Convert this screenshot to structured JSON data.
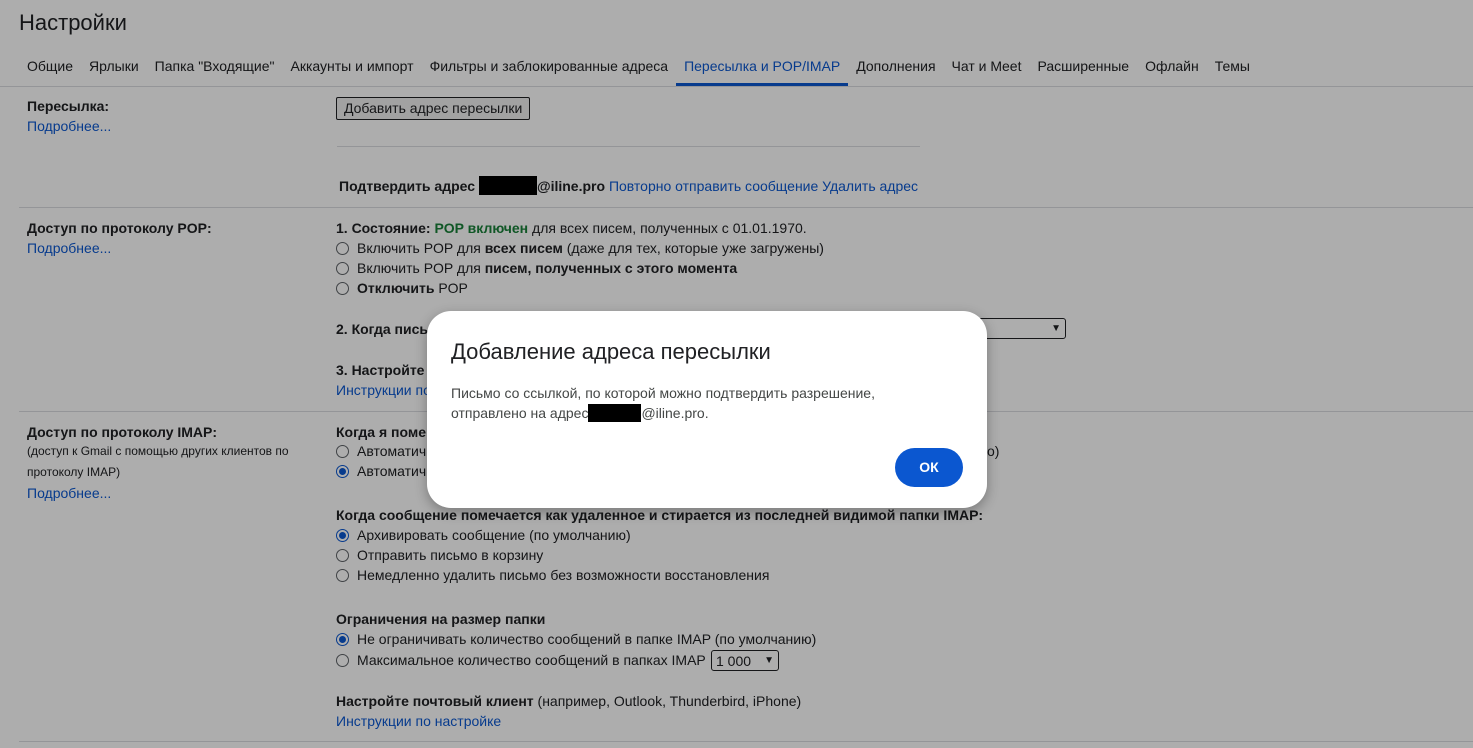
{
  "page_title": "Настройки",
  "tabs": [
    {
      "label": "Общие"
    },
    {
      "label": "Ярлыки"
    },
    {
      "label": "Папка \"Входящие\""
    },
    {
      "label": "Аккаунты и импорт"
    },
    {
      "label": "Фильтры и заблокированные адреса"
    },
    {
      "label": "Пересылка и POP/IMAP",
      "active": true
    },
    {
      "label": "Дополнения"
    },
    {
      "label": "Чат и Meet"
    },
    {
      "label": "Расширенные"
    },
    {
      "label": "Офлайн"
    },
    {
      "label": "Темы"
    }
  ],
  "forwarding": {
    "label": "Пересылка:",
    "more": "Подробнее...",
    "add_button": "Добавить адрес пересылки",
    "confirm_prefix": "Подтвердить адрес",
    "confirm_domain": "@iline.pro",
    "resend_link": "Повторно отправить сообщение",
    "delete_link": "Удалить адрес"
  },
  "pop": {
    "label": "Доступ по протоколу POP:",
    "more": "Подробнее...",
    "status_prefix": "1. Состояние:",
    "status_value": "POP включен",
    "status_suffix": "для всех писем, полученных с 01.01.1970.",
    "opt1_a": "Включить POP для",
    "opt1_b": "всех писем",
    "opt1_c": "(даже для тех, которые уже загружены)",
    "opt2_a": "Включить POP для",
    "opt2_b": "писем, полученных с этого момента",
    "opt3_a": "Отключить",
    "opt3_b": "POP",
    "q2": "2. Когда пись",
    "q3": "3. Настройте",
    "q3_link": "Инструкции по"
  },
  "imap": {
    "label": "Доступ по протоколу IMAP:",
    "sub": "(доступ к Gmail с помощью других клиентов по протоколу IMAP)",
    "more": "Подробнее...",
    "q1": "Когда я поме",
    "q1_opt1": "Автоматич",
    "q1_opt2": "Автоматич",
    "q1_tail": "о)",
    "q2": "Когда сообщение помечается как удаленное и стирается из последней видимой папки IMAP:",
    "q2_opt1": "Архивировать сообщение (по умолчанию)",
    "q2_opt2": "Отправить письмо в корзину",
    "q2_opt3": "Немедленно удалить письмо без возможности восстановления",
    "limit_title": "Ограничения на размер папки",
    "limit_opt1": "Не ограничивать количество сообщений в папке IMAP (по умолчанию)",
    "limit_opt2": "Максимальное количество сообщений в папках IMAP",
    "limit_select": "1 000",
    "client_bold": "Настройте почтовый клиент",
    "client_rest": "(например, Outlook, Thunderbird, iPhone)",
    "client_link": "Инструкции по настройке"
  },
  "dialog": {
    "title": "Добавление адреса пересылки",
    "body_line1": "Письмо со ссылкой, по которой можно подтвердить разрешение,",
    "body_line2_prefix": "отправлено на адрес",
    "body_line2_suffix": "@iline.pro.",
    "ok_label": "ОК"
  },
  "colors": {
    "accent": "#0b57d0",
    "status_green": "#188038",
    "overlay": "rgba(0,0,0,0.32)"
  }
}
